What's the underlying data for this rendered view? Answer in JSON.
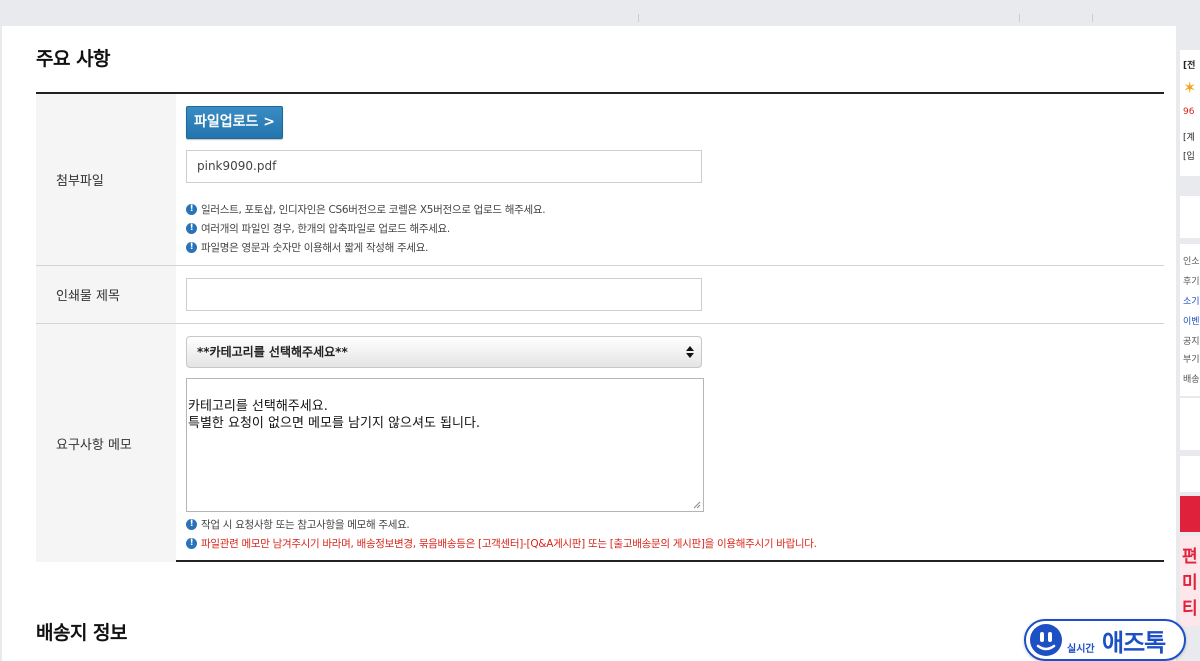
{
  "notice_section": {
    "title": "주요 사항",
    "attachment": {
      "label": "첨부파일",
      "upload_button": "파일업로드 >",
      "file_value": "pink9090.pdf",
      "notes": [
        "일러스트, 포토샵, 인디자인은 CS6버전으로 코렐은 X5버전으로 업로드 해주세요.",
        "여러개의 파일인 경우, 한개의 압축파일로 업로드 해주세요.",
        "파일명은 영문과 숫자만 이용해서 짧게 작성해 주세요."
      ]
    },
    "print_title": {
      "label": "인쇄물 제목",
      "value": ""
    },
    "memo": {
      "label": "요구사항 메모",
      "category_selected": "**카테고리를 선택해주세요**",
      "memo_text": "카테고리를 선택해주세요.\n특별한 요청이 없으면 메모를 남기지 않으셔도 됩니다.",
      "notes": [
        "작업 시 요청사항 또는 참고사항을 메모해 주세요."
      ],
      "warning_note": "파일관련 메모만 남겨주시기 바라며, 배송정보변경, 묶음배송등은 [고객센터]-[Q&A게시판] 또는 [출고배송문의 게시판]을 이용해주시기 바랍니다."
    }
  },
  "shipping_section": {
    "title": "배송지 정보"
  },
  "side_panel": {
    "fragments_top": [
      "[전",
      "96",
      "[계",
      "[입"
    ],
    "fragments_mid": [
      "인소",
      "후기",
      "소기",
      "이벤",
      "공지",
      "부기",
      "배송"
    ],
    "fragments_bottom": [
      "편",
      "미",
      "티"
    ]
  },
  "chat_badge": {
    "small_label": "실시간",
    "big_label": "애즈톡"
  },
  "colors": {
    "accent_blue": "#2474ad",
    "warning_red": "#d9261c",
    "chat_blue": "#1d50c4",
    "side_red": "#e0213c"
  }
}
